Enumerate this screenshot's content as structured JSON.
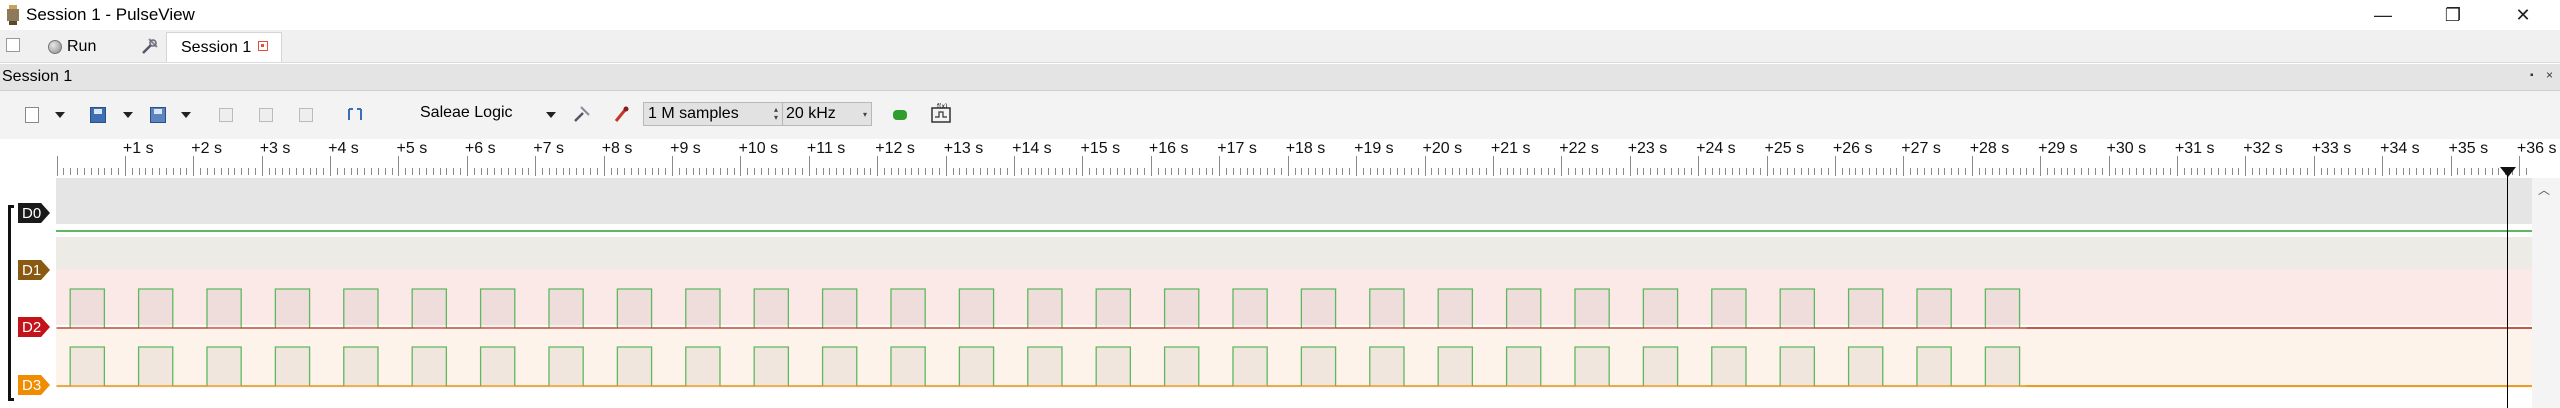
{
  "window": {
    "title": "Session 1 - PulseView",
    "minimize": "—",
    "maximize": "❐",
    "close": "✕"
  },
  "tabbar": {
    "run_label": "Run",
    "session_tab_label": "Session 1"
  },
  "session_header": {
    "title": "Session 1",
    "float_glyph": "▪",
    "close_glyph": "×"
  },
  "toolbar": {
    "device": "Saleae Logic",
    "samples": "1 M samples",
    "sample_rate": "20 kHz"
  },
  "ruler": {
    "labels": [
      "+1 s",
      "+2 s",
      "+3 s",
      "+4 s",
      "+5 s",
      "+6 s",
      "+7 s",
      "+8 s",
      "+9 s",
      "+10 s",
      "+11 s",
      "+12 s",
      "+13 s",
      "+14 s",
      "+15 s",
      "+16 s",
      "+17 s",
      "+18 s",
      "+19 s",
      "+20 s",
      "+21 s",
      "+22 s",
      "+23 s",
      "+24 s",
      "+25 s",
      "+26 s",
      "+27 s",
      "+28 s",
      "+29 s",
      "+30 s",
      "+31 s",
      "+32 s",
      "+33 s",
      "+34 s",
      "+35 s",
      "+36 s"
    ]
  },
  "channels": [
    {
      "name": "D0",
      "color": "#1a1a1a",
      "bg": "#e5e5e5",
      "trace": "none"
    },
    {
      "name": "D1",
      "color": "#8a5a12",
      "bg": "#ecebe6",
      "trace": "low",
      "trace_color": "#5fb85f"
    },
    {
      "name": "D2",
      "color": "#c2141a",
      "bg": "#fbe9e7",
      "trace": "pulses",
      "trace_color": "#c0392b",
      "high_color": "#5fb85f"
    },
    {
      "name": "D3",
      "color": "#f08c00",
      "bg": "#fdf3ea",
      "trace": "pulses",
      "trace_color": "#f08c00",
      "high_color": "#5fb85f"
    }
  ],
  "signal": {
    "pulse_count": 29,
    "pulse_period_s": 1.0,
    "pulse_high_s": 0.5,
    "capture_end_s": 28.8
  },
  "colors": {
    "accent_run": "#888888",
    "go_arrow": "#2f9e2f",
    "session_close": "#e0503a"
  }
}
